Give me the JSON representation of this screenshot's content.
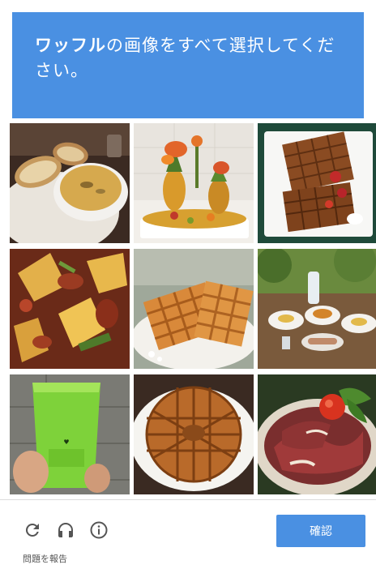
{
  "header": {
    "prompt_keyword": "ワッフル",
    "prompt_rest": "の画像をすべて選択してください。"
  },
  "tiles": [
    {
      "subject": "bread-and-soup-bowl"
    },
    {
      "subject": "pineapple-vegetable-carving"
    },
    {
      "subject": "waffles-with-strawberries"
    },
    {
      "subject": "potato-stew"
    },
    {
      "subject": "waffles-on-plate"
    },
    {
      "subject": "breakfast-table-outdoors"
    },
    {
      "subject": "green-smoothie-cup"
    },
    {
      "subject": "round-waffle-on-plate"
    },
    {
      "subject": "roast-beef-salad"
    }
  ],
  "controls": {
    "reload_icon": "reload-icon",
    "audio_icon": "headphones-icon",
    "info_icon": "info-icon"
  },
  "footer": {
    "verify_label": "確認",
    "report_label": "問題を報告"
  },
  "colors": {
    "accent": "#4a90e2",
    "icon": "#555555"
  }
}
